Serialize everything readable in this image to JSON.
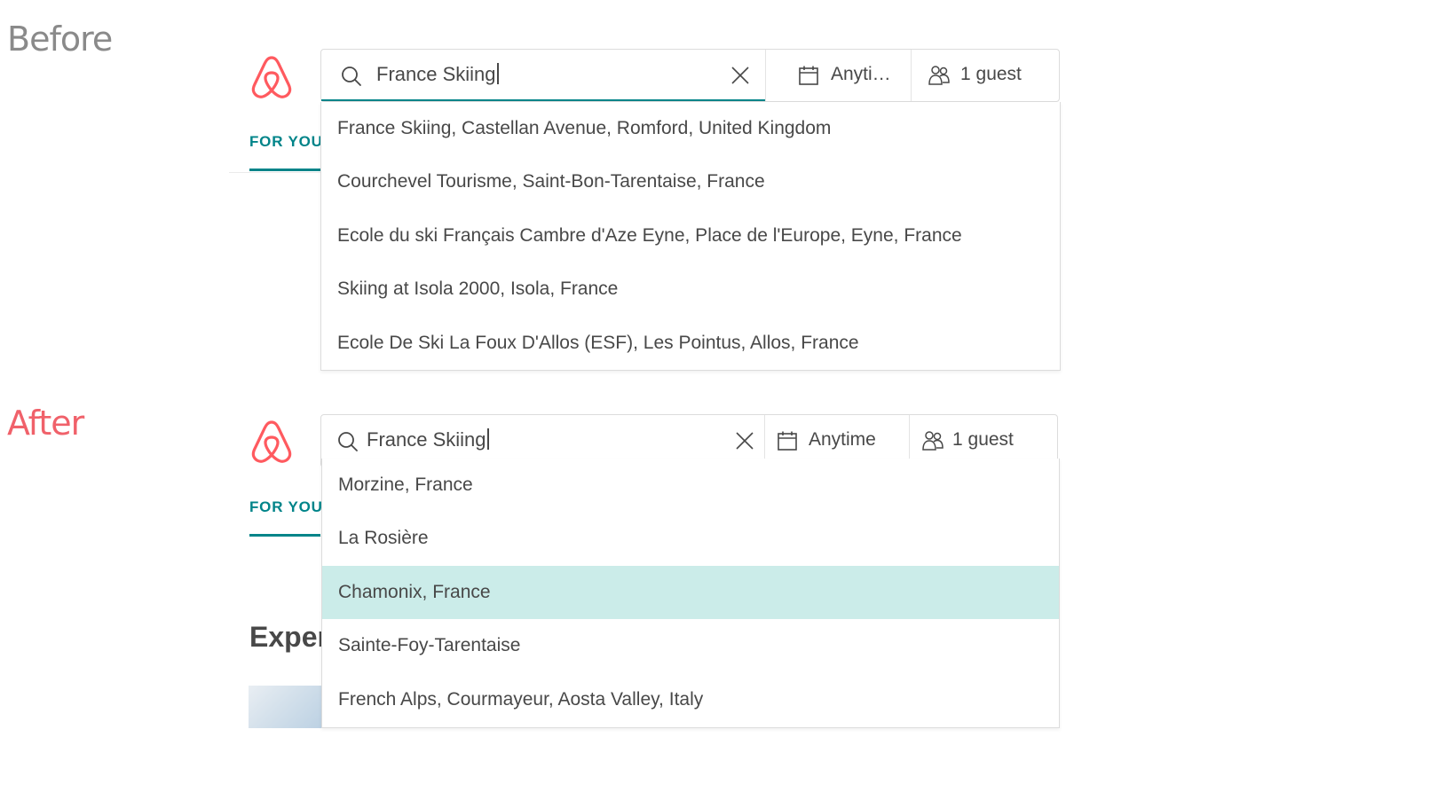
{
  "labels": {
    "before": "Before",
    "after": "After"
  },
  "colors": {
    "accent": "#008489",
    "brand": "#FF5A5F",
    "highlight": "#CBECE9",
    "before_label": "#8A8A8A",
    "after_label": "#F0616A"
  },
  "before": {
    "tab": "FOR YOU",
    "search": {
      "value": "France Skiing",
      "icon": "search-icon",
      "clear_icon": "close-icon"
    },
    "date": {
      "icon": "calendar-icon",
      "label": "Anyti…"
    },
    "guests": {
      "icon": "guests-icon",
      "label": "1 guest"
    },
    "suggestions": [
      "France Skiing, Castellan Avenue, Romford, United Kingdom",
      "Courchevel Tourisme, Saint-Bon-Tarentaise, France",
      "Ecole du ski Français Cambre d'Aze Eyne, Place de l'Europe, Eyne, France",
      "Skiing at Isola 2000, Isola, France",
      "Ecole De Ski La Foux D'Allos (ESF), Les Pointus, Allos, France"
    ]
  },
  "after": {
    "tab": "FOR YOU",
    "heading": "Exper",
    "search": {
      "value": "France Skiing",
      "icon": "search-icon",
      "clear_icon": "close-icon"
    },
    "date": {
      "icon": "calendar-icon",
      "label": "Anytime"
    },
    "guests": {
      "icon": "guests-icon",
      "label": "1 guest"
    },
    "suggestions": [
      "Morzine, France",
      "La Rosière",
      "Chamonix, France",
      "Sainte-Foy-Tarentaise",
      "French Alps, Courmayeur, Aosta Valley, Italy"
    ],
    "highlighted_index": 2
  }
}
